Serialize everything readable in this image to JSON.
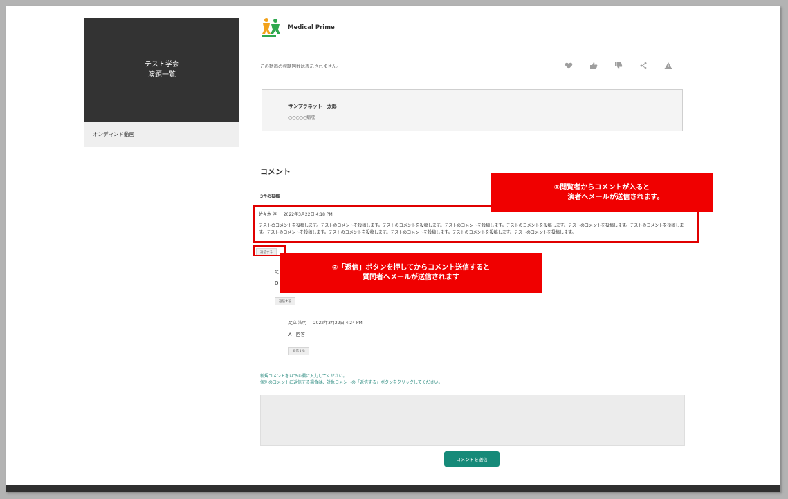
{
  "sidebar": {
    "title_line1": "テスト学会",
    "title_line2": "演題一覧",
    "menu_item": "オンデマンド動画"
  },
  "header": {
    "brand": "Medical Prime",
    "view_notice": "この動画の視聴回数は表示されません。",
    "actions": [
      "heart-icon",
      "thumbs-up-icon",
      "thumbs-down-icon",
      "share-icon",
      "warning-icon"
    ]
  },
  "presenter": {
    "name": "サンプラネット　太郎",
    "affiliation": "○○○○○病院"
  },
  "comments": {
    "heading": "コメント",
    "count_label": "3件の投稿",
    "items": [
      {
        "author": "佐々木 淳",
        "datetime": "2022年3月22日 4:18 PM",
        "body": "テストのコメントを投稿します。テストのコメントを投稿します。テストのコメントを投稿します。テストのコメントを投稿します。テストのコメントを投稿します。テストのコメントを投稿します。テストのコメントを投稿します。テストのコメントを投稿します。テストのコメントを投稿します。テストのコメントを投稿します。テストのコメントを投稿します。テストのコメントを投稿します。",
        "reply_label": "返信する"
      },
      {
        "author": "足",
        "body": "Q",
        "reply_label": "返信する"
      },
      {
        "author": "足立 浩明",
        "datetime": "2022年3月22日 4:24 PM",
        "body": "A　回答",
        "reply_label": "返信する"
      }
    ]
  },
  "callouts": {
    "first_line1": "①閲覧者からコメントが入ると",
    "first_line2": "演者へメールが送信されます。",
    "second_line1": "②「返信」ボタンを押してからコメント送信すると",
    "second_line2": "質問者へメールが送信されます"
  },
  "new_comment": {
    "note_line1": "新規コメントを以下の欄に入力してください。",
    "note_line2": "個別のコメントに返信する場合は、対象コメントの「返信する」ボタンをクリックしてください。",
    "input_value": "",
    "submit_label": "コメントを送信"
  },
  "colors": {
    "accent": "#168a79",
    "callout": "#f00000",
    "sidebar": "#333333"
  }
}
